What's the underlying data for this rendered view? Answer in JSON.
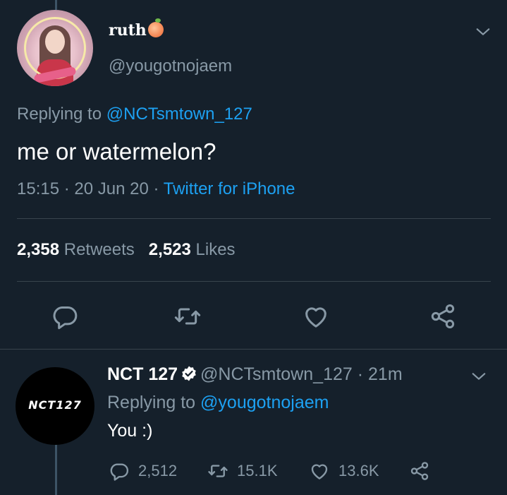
{
  "main_tweet": {
    "display_name": "ruth",
    "handle": "@yougotnojaem",
    "replying_label": "Replying to",
    "replying_to": "@NCTsmtown_127",
    "text": "me or watermelon?",
    "time": "15:15",
    "date": "20 Jun 20",
    "separator": "·",
    "client": "Twitter for iPhone",
    "retweets_count": "2,358",
    "retweets_label": "Retweets",
    "likes_count": "2,523",
    "likes_label": "Likes"
  },
  "reply": {
    "display_name": "NCT 127",
    "handle": "@NCTsmtown_127",
    "separator": "·",
    "age": "21m",
    "replying_label": "Replying to",
    "replying_to": "@yougotnojaem",
    "text": "You :)",
    "avatar_logo": "NCT127",
    "reply_count": "2,512",
    "retweet_count": "15.1K",
    "like_count": "13.6K"
  },
  "colors": {
    "background": "#15202b",
    "text": "#ffffff",
    "secondary": "#8899a6",
    "link": "#1da1f2",
    "divider": "#38444d"
  },
  "icons": [
    "chevron-down-icon",
    "reply-icon",
    "retweet-icon",
    "like-icon",
    "share-icon",
    "verified-badge-icon",
    "peach-emoji-icon"
  ]
}
